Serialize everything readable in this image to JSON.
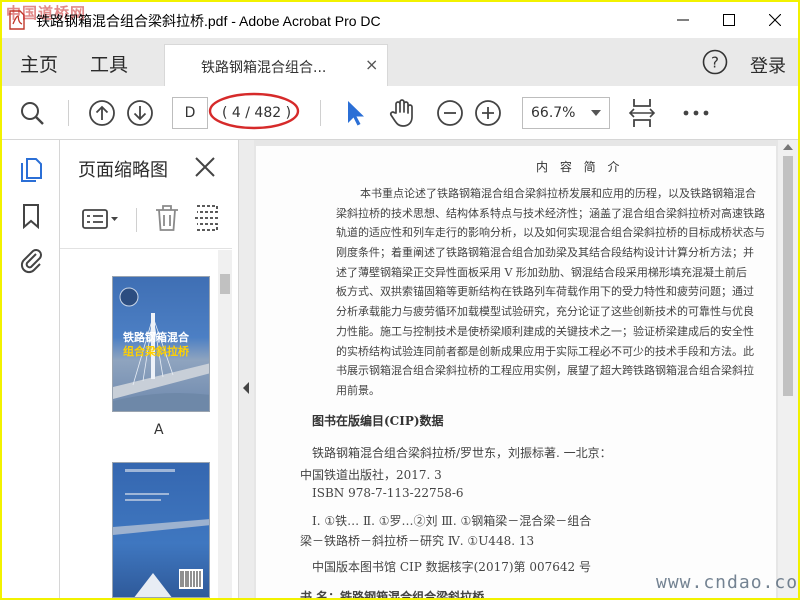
{
  "window": {
    "title": "铁路钢箱混合组合梁斜拉桥.pdf - Adobe Acrobat Pro DC",
    "watermark_top": "中国道桥网",
    "watermark_bottom": "www.cndao.com"
  },
  "nav": {
    "home": "主页",
    "tools": "工具",
    "doc_tab": "铁路钢箱混合组合...",
    "close_glyph": "×",
    "help_glyph": "?",
    "login": "登录"
  },
  "toolbar": {
    "page_number": "D",
    "page_count": "( 4 / 482 )",
    "zoom": "66.7%"
  },
  "panel": {
    "title": "页面缩略图",
    "thumb1_label": "A",
    "cover_title_line1": "铁路钢箱混合",
    "cover_title_line2": "组合梁斜拉桥"
  },
  "document": {
    "section_title": "内 容 简 介",
    "paragraph_lines": [
      "本书重点论述了铁路钢箱混合组合梁斜拉桥发展和应用的历程，以及铁路钢箱混合",
      "梁斜拉桥的技术思想、结构体系特点与技术经济性；涵盖了混合组合梁斜拉桥对高速铁路",
      "轨道的适应性和列车走行的影响分析，以及如何实现混合组合梁斜拉桥的目标成桥状态与",
      "刚度条件；着重阐述了铁路钢箱混合组合加劲梁及其结合段结构设计计算分析方法；并",
      "述了薄壁钢箱梁正交异性面板采用 V 形加劲肋、钢混结合段采用梯形填充混凝土前后",
      "板方式、双拱索锚固箱等更新结构在铁路列车荷载作用下的受力特性和疲劳问题；通过",
      "分析承载能力与疲劳循环加载模型试验研究，充分论证了这些创新技术的可靠性与优良",
      "力性能。施工与控制技术是使桥梁顺利建成的关键技术之一；验证桥梁建成后的安全性",
      "的实桥结构试验连同前者都是创新成果应用于实际工程必不可少的技术手段和方法。此",
      "书展示钢箱混合组合梁斜拉桥的工程应用实例，展望了超大跨铁路钢箱混合组合梁斜拉",
      "用前景。"
    ],
    "cip_heading": "图书在版编目(CIP)数据",
    "cip_line1": "铁路钢箱混合组合梁斜拉桥/罗世东，刘振标著. 一北京：",
    "cip_line2": "中国铁道出版社，2017. 3",
    "cip_line3": "ISBN 978-7-113-22758-6",
    "cip_line4": "Ⅰ. ①铁…  Ⅱ. ①罗…②刘  Ⅲ. ①钢箱梁－混合梁－组合",
    "cip_line5": "梁－铁路桥－斜拉桥－研究  Ⅳ. ①U448. 13",
    "cip_line6": "中国版本图书馆 CIP 数据核字(2017)第 007642 号",
    "cip_line7": "书      名：铁路钢箱混合组合梁斜拉桥"
  },
  "colors": {
    "accent_blue": "#2b6fd6",
    "annotation_red": "#d62a2a",
    "border_yellow": "#f2f200"
  }
}
